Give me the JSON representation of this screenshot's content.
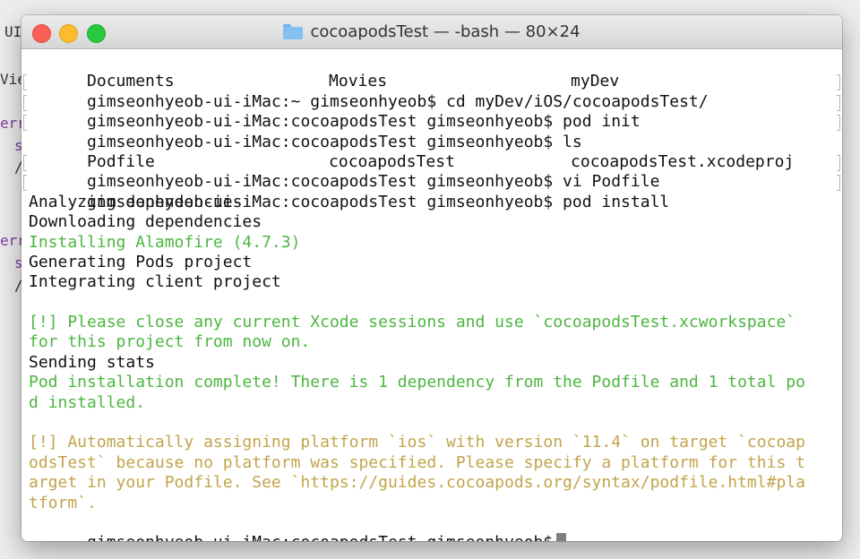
{
  "window": {
    "title": "cocoapodsTest — -bash — 80×24"
  },
  "background_fragments": [
    {
      "text": "UI",
      "color": "#333"
    },
    {
      "text": "Vie",
      "color": "#333"
    },
    {
      "text": "err",
      "color": "#7a3e9d"
    },
    {
      "text": "s",
      "color": "#7a3e9d"
    },
    {
      "text": "/",
      "color": "#333"
    },
    {
      "text": "err",
      "color": "#7a3e9d"
    },
    {
      "text": "s",
      "color": "#7a3e9d"
    },
    {
      "text": "/",
      "color": "#333"
    }
  ],
  "terminal": {
    "ls_row": {
      "c1": "Documents",
      "c2": "Movies",
      "c3": "myDev"
    },
    "cmd1": "gimseonhyeob-ui-iMac:~ gimseonhyeob$ cd myDev/iOS/cocoapodsTest/",
    "cmd2": "gimseonhyeob-ui-iMac:cocoapodsTest gimseonhyeob$ pod init",
    "cmd3": "gimseonhyeob-ui-iMac:cocoapodsTest gimseonhyeob$ ls",
    "ls_row2": {
      "c1": "Podfile",
      "c2": "cocoapodsTest",
      "c3": "cocoapodsTest.xcodeproj"
    },
    "cmd4": "gimseonhyeob-ui-iMac:cocoapodsTest gimseonhyeob$ vi Podfile",
    "cmd5": "gimseonhyeob-ui-iMac:cocoapodsTest gimseonhyeob$ pod install",
    "out1": "Analyzing dependencies",
    "out2": "Downloading dependencies",
    "out3": "Installing Alamofire (4.7.3)",
    "out4": "Generating Pods project",
    "out5": "Integrating client project",
    "warn1a": "[!] Please close any current Xcode sessions and use `cocoapodsTest.xcworkspace`",
    "warn1b": "for this project from now on.",
    "out6": "Sending stats",
    "done1": "Pod installation complete! There is 1 dependency from the Podfile and 1 total po",
    "done2": "d installed.",
    "warn2a": "[!] Automatically assigning platform `ios` with version `11.4` on target `cocoap",
    "warn2b": "odsTest` because no platform was specified. Please specify a platform for this t",
    "warn2c": "arget in your Podfile. See `https://guides.cocoapods.org/syntax/podfile.html#pla",
    "warn2d": "tform`.",
    "prompt": "gimseonhyeob-ui-iMac:cocoapodsTest gimseonhyeob$"
  },
  "colors": {
    "green": "#4cb640",
    "yellow": "#c2a44b",
    "close": "#fc5f57",
    "minimize": "#fdbb2e",
    "maximize": "#28c840"
  }
}
